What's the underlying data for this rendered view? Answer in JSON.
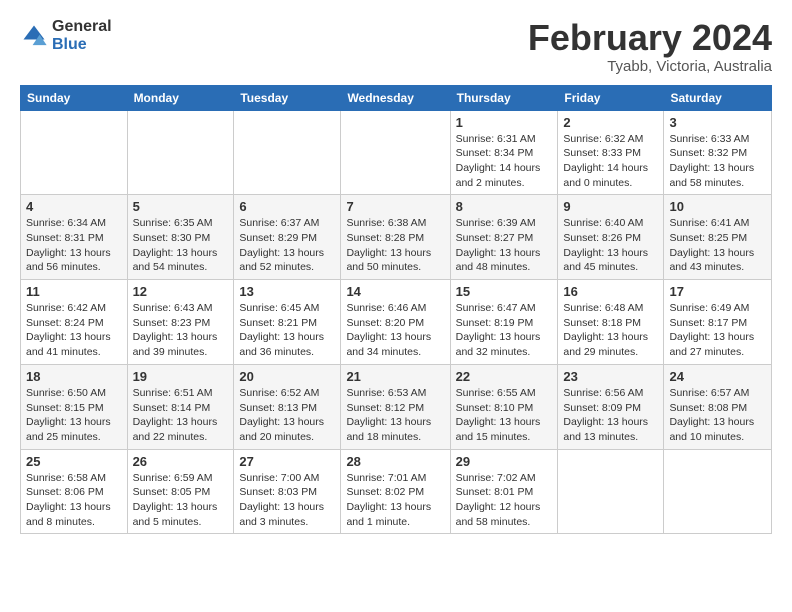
{
  "logo": {
    "general": "General",
    "blue": "Blue"
  },
  "title": "February 2024",
  "location": "Tyabb, Victoria, Australia",
  "days_header": [
    "Sunday",
    "Monday",
    "Tuesday",
    "Wednesday",
    "Thursday",
    "Friday",
    "Saturday"
  ],
  "weeks": [
    [
      {
        "day": "",
        "info": ""
      },
      {
        "day": "",
        "info": ""
      },
      {
        "day": "",
        "info": ""
      },
      {
        "day": "",
        "info": ""
      },
      {
        "day": "1",
        "info": "Sunrise: 6:31 AM\nSunset: 8:34 PM\nDaylight: 14 hours\nand 2 minutes."
      },
      {
        "day": "2",
        "info": "Sunrise: 6:32 AM\nSunset: 8:33 PM\nDaylight: 14 hours\nand 0 minutes."
      },
      {
        "day": "3",
        "info": "Sunrise: 6:33 AM\nSunset: 8:32 PM\nDaylight: 13 hours\nand 58 minutes."
      }
    ],
    [
      {
        "day": "4",
        "info": "Sunrise: 6:34 AM\nSunset: 8:31 PM\nDaylight: 13 hours\nand 56 minutes."
      },
      {
        "day": "5",
        "info": "Sunrise: 6:35 AM\nSunset: 8:30 PM\nDaylight: 13 hours\nand 54 minutes."
      },
      {
        "day": "6",
        "info": "Sunrise: 6:37 AM\nSunset: 8:29 PM\nDaylight: 13 hours\nand 52 minutes."
      },
      {
        "day": "7",
        "info": "Sunrise: 6:38 AM\nSunset: 8:28 PM\nDaylight: 13 hours\nand 50 minutes."
      },
      {
        "day": "8",
        "info": "Sunrise: 6:39 AM\nSunset: 8:27 PM\nDaylight: 13 hours\nand 48 minutes."
      },
      {
        "day": "9",
        "info": "Sunrise: 6:40 AM\nSunset: 8:26 PM\nDaylight: 13 hours\nand 45 minutes."
      },
      {
        "day": "10",
        "info": "Sunrise: 6:41 AM\nSunset: 8:25 PM\nDaylight: 13 hours\nand 43 minutes."
      }
    ],
    [
      {
        "day": "11",
        "info": "Sunrise: 6:42 AM\nSunset: 8:24 PM\nDaylight: 13 hours\nand 41 minutes."
      },
      {
        "day": "12",
        "info": "Sunrise: 6:43 AM\nSunset: 8:23 PM\nDaylight: 13 hours\nand 39 minutes."
      },
      {
        "day": "13",
        "info": "Sunrise: 6:45 AM\nSunset: 8:21 PM\nDaylight: 13 hours\nand 36 minutes."
      },
      {
        "day": "14",
        "info": "Sunrise: 6:46 AM\nSunset: 8:20 PM\nDaylight: 13 hours\nand 34 minutes."
      },
      {
        "day": "15",
        "info": "Sunrise: 6:47 AM\nSunset: 8:19 PM\nDaylight: 13 hours\nand 32 minutes."
      },
      {
        "day": "16",
        "info": "Sunrise: 6:48 AM\nSunset: 8:18 PM\nDaylight: 13 hours\nand 29 minutes."
      },
      {
        "day": "17",
        "info": "Sunrise: 6:49 AM\nSunset: 8:17 PM\nDaylight: 13 hours\nand 27 minutes."
      }
    ],
    [
      {
        "day": "18",
        "info": "Sunrise: 6:50 AM\nSunset: 8:15 PM\nDaylight: 13 hours\nand 25 minutes."
      },
      {
        "day": "19",
        "info": "Sunrise: 6:51 AM\nSunset: 8:14 PM\nDaylight: 13 hours\nand 22 minutes."
      },
      {
        "day": "20",
        "info": "Sunrise: 6:52 AM\nSunset: 8:13 PM\nDaylight: 13 hours\nand 20 minutes."
      },
      {
        "day": "21",
        "info": "Sunrise: 6:53 AM\nSunset: 8:12 PM\nDaylight: 13 hours\nand 18 minutes."
      },
      {
        "day": "22",
        "info": "Sunrise: 6:55 AM\nSunset: 8:10 PM\nDaylight: 13 hours\nand 15 minutes."
      },
      {
        "day": "23",
        "info": "Sunrise: 6:56 AM\nSunset: 8:09 PM\nDaylight: 13 hours\nand 13 minutes."
      },
      {
        "day": "24",
        "info": "Sunrise: 6:57 AM\nSunset: 8:08 PM\nDaylight: 13 hours\nand 10 minutes."
      }
    ],
    [
      {
        "day": "25",
        "info": "Sunrise: 6:58 AM\nSunset: 8:06 PM\nDaylight: 13 hours\nand 8 minutes."
      },
      {
        "day": "26",
        "info": "Sunrise: 6:59 AM\nSunset: 8:05 PM\nDaylight: 13 hours\nand 5 minutes."
      },
      {
        "day": "27",
        "info": "Sunrise: 7:00 AM\nSunset: 8:03 PM\nDaylight: 13 hours\nand 3 minutes."
      },
      {
        "day": "28",
        "info": "Sunrise: 7:01 AM\nSunset: 8:02 PM\nDaylight: 13 hours\nand 1 minute."
      },
      {
        "day": "29",
        "info": "Sunrise: 7:02 AM\nSunset: 8:01 PM\nDaylight: 12 hours\nand 58 minutes."
      },
      {
        "day": "",
        "info": ""
      },
      {
        "day": "",
        "info": ""
      }
    ]
  ]
}
